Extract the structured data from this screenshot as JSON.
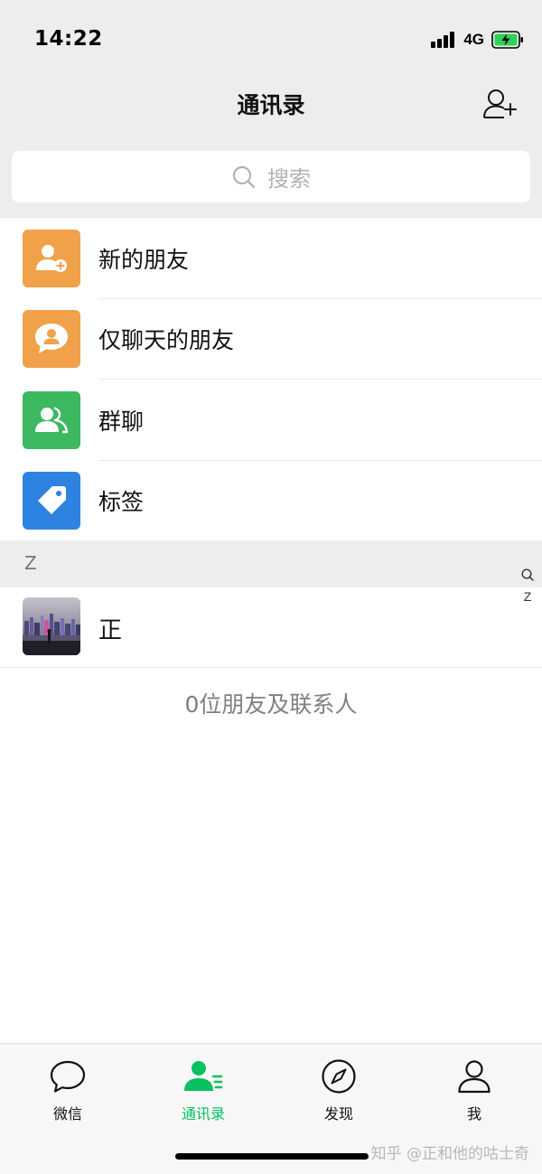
{
  "status_bar": {
    "time": "14:22",
    "network": "4G",
    "battery_color": "#30d158"
  },
  "nav": {
    "title": "通讯录",
    "add_friend_icon": "add-contact-icon"
  },
  "search": {
    "placeholder": "搜索"
  },
  "function_items": [
    {
      "label": "新的朋友",
      "icon": "new-friend-icon",
      "color": "#fa9d3b"
    },
    {
      "label": "仅聊天的朋友",
      "icon": "chat-only-friend-icon",
      "color": "#fa9d3b"
    },
    {
      "label": "群聊",
      "icon": "group-chat-icon",
      "color": "#07c160"
    },
    {
      "label": "标签",
      "icon": "tag-icon",
      "color": "#2782d7"
    }
  ],
  "contacts": {
    "section_letter": "Z",
    "items": [
      {
        "name": "正",
        "avatar": "city-night-photo"
      }
    ]
  },
  "index_bar": {
    "letters": [
      "Z"
    ]
  },
  "footer": {
    "count_text": "0位朋友及联系人"
  },
  "tab_bar": {
    "tabs": [
      {
        "label": "微信",
        "icon": "chat-bubble-icon",
        "active": false
      },
      {
        "label": "通讯录",
        "icon": "contacts-icon",
        "active": true
      },
      {
        "label": "发现",
        "icon": "compass-icon",
        "active": false
      },
      {
        "label": "我",
        "icon": "person-icon",
        "active": false
      }
    ],
    "active_color": "#07c160"
  },
  "watermark": "知乎 @正和他的咕士奇"
}
